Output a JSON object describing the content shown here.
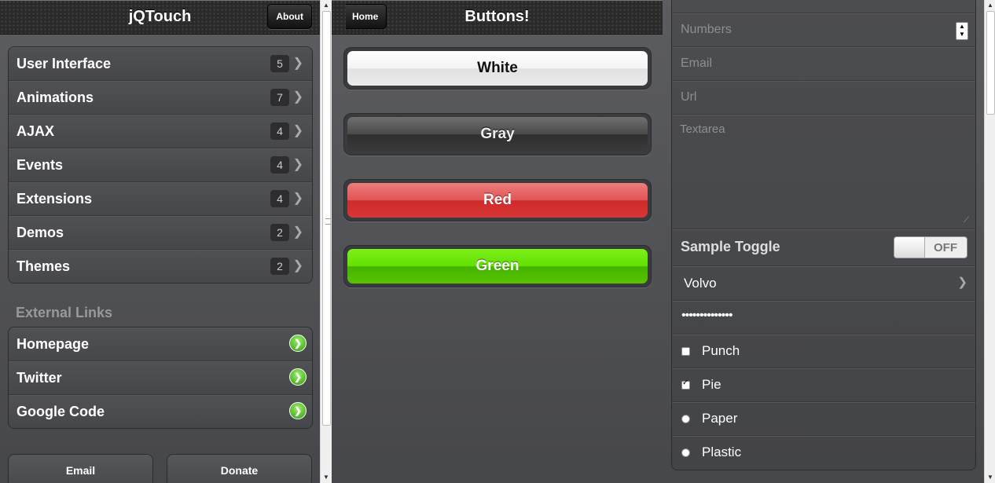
{
  "left": {
    "title": "jQTouch",
    "about_label": "About",
    "menu": [
      {
        "label": "User Interface",
        "count": "5"
      },
      {
        "label": "Animations",
        "count": "7"
      },
      {
        "label": "AJAX",
        "count": "4"
      },
      {
        "label": "Events",
        "count": "4"
      },
      {
        "label": "Extensions",
        "count": "4"
      },
      {
        "label": "Demos",
        "count": "2"
      },
      {
        "label": "Themes",
        "count": "2"
      }
    ],
    "external_heading": "External Links",
    "external": [
      {
        "label": "Homepage"
      },
      {
        "label": "Twitter"
      },
      {
        "label": "Google Code"
      }
    ],
    "footer": {
      "email_label": "Email",
      "donate_label": "Donate"
    }
  },
  "middle": {
    "title": "Buttons!",
    "back_label": "Home",
    "buttons": [
      {
        "label": "White",
        "color": "#f3f3f3"
      },
      {
        "label": "Gray",
        "color": "#4a4a4a"
      },
      {
        "label": "Red",
        "color": "#e05454"
      },
      {
        "label": "Green",
        "color": "#62e000"
      }
    ]
  },
  "right": {
    "numbers_placeholder": "Numbers",
    "email_placeholder": "Email",
    "url_placeholder": "Url",
    "textarea_placeholder": "Textarea",
    "toggle_label": "Sample Toggle",
    "toggle_state": "OFF",
    "select_value": "Volvo",
    "password_value": "••••••••••••••",
    "checkboxes": [
      {
        "label": "Punch",
        "checked": false
      },
      {
        "label": "Pie",
        "checked": true
      }
    ],
    "radios": [
      {
        "label": "Paper"
      },
      {
        "label": "Plastic"
      }
    ]
  },
  "icons": {
    "chevron": "❯",
    "external_arrow": "❯",
    "scroll_up": "▲",
    "scroll_down": "▼",
    "stepper_up": "▲",
    "stepper_down": "▼"
  }
}
